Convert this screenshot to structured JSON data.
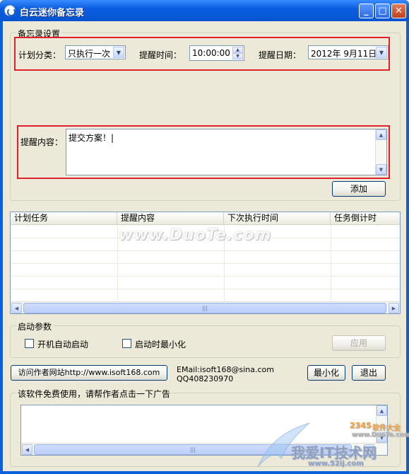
{
  "window": {
    "title": "白云迷你备忘录"
  },
  "settings": {
    "group_title": "备忘录设置",
    "plan_type_label": "计划分类：",
    "plan_type_value": "只执行一次",
    "remind_time_label": "提醒时间：",
    "remind_time_value": "10:00:00",
    "remind_date_label": "提醒日期：",
    "remind_date_value": "2012年  9月11日",
    "content_label": "提醒内容：",
    "content_value": "提交方案！|",
    "add_button": "添加"
  },
  "task_list": {
    "columns": [
      "计划任务",
      "提醒内容",
      "下次执行时间",
      "任务倒计时"
    ],
    "rows": []
  },
  "startup": {
    "group_title": "启动参数",
    "auto_start_label": "开机自动启动",
    "start_minimized_label": "启动时最小化",
    "apply_button": "应用"
  },
  "footer": {
    "author_site_button": "访问作者网站http://www.isoft168.com",
    "email_text": "EMail:isoft168@sina.com",
    "qq_text": "QQ408230970",
    "minimize_button": "最小化",
    "exit_button": "退出"
  },
  "ads": {
    "group_title": "该软件免费使用，请帮作者点击一下广告"
  },
  "watermarks": {
    "duote": "www.DuoTe.com",
    "brand_2345": "2345",
    "brand_suffix": "软件大全",
    "site_url": "www.DuoTe.com",
    "site_slogan": "我爱IT技术网",
    "site_domain": "www.52ij.com"
  },
  "colors": {
    "highlight": "#e0202a",
    "title_bar": "#0b5ee0"
  }
}
